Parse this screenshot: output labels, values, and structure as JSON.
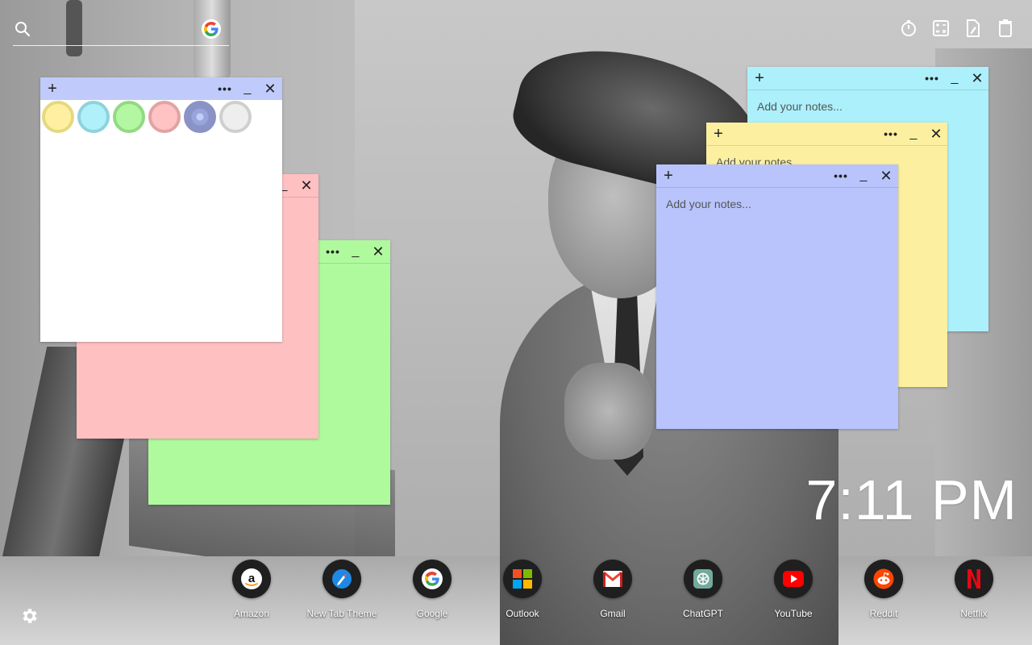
{
  "search": {
    "placeholder": ""
  },
  "top_tools": [
    {
      "name": "timer-icon"
    },
    {
      "name": "calculator-icon"
    },
    {
      "name": "scratchpad-icon"
    },
    {
      "name": "trash-icon"
    }
  ],
  "notes": {
    "placeholder": "Add your notes...",
    "plus": "+",
    "more": "•••",
    "minimize": "_",
    "close": "✕",
    "colors": {
      "white": "#ffffff",
      "pink": "#ffc0c2",
      "green": "#b0fa9e",
      "cyan": "#acf0fb",
      "yellow": "#fcf0a0",
      "blue": "#b8c4fb",
      "picker_header": "#c0cbfb"
    },
    "swatches": [
      {
        "name": "yellow-swatch",
        "fill": "#fef0a0",
        "ring": "#e5d980"
      },
      {
        "name": "cyan-swatch",
        "fill": "#aff0fb",
        "ring": "#8fd2dd"
      },
      {
        "name": "green-swatch",
        "fill": "#b3f7a2",
        "ring": "#93d984"
      },
      {
        "name": "pink-swatch",
        "fill": "#ffc3c4",
        "ring": "#e1a3a4"
      },
      {
        "name": "blue-swatch",
        "fill": "#8a93c6",
        "ring": "#8a93c6"
      },
      {
        "name": "grey-swatch",
        "fill": "#eeeeee",
        "ring": "#cfcfcf"
      }
    ]
  },
  "clock": {
    "time": "7:11 PM"
  },
  "dock": [
    {
      "label": "Amazon",
      "icon": "amazon-icon"
    },
    {
      "label": "New Tab Theme",
      "icon": "new-tab-theme-icon"
    },
    {
      "label": "Google",
      "icon": "google-icon"
    },
    {
      "label": "Outlook",
      "icon": "outlook-icon"
    },
    {
      "label": "Gmail",
      "icon": "gmail-icon"
    },
    {
      "label": "ChatGPT",
      "icon": "chatgpt-icon"
    },
    {
      "label": "YouTube",
      "icon": "youtube-icon"
    },
    {
      "label": "Reddit",
      "icon": "reddit-icon"
    },
    {
      "label": "Netflix",
      "icon": "netflix-icon"
    }
  ]
}
